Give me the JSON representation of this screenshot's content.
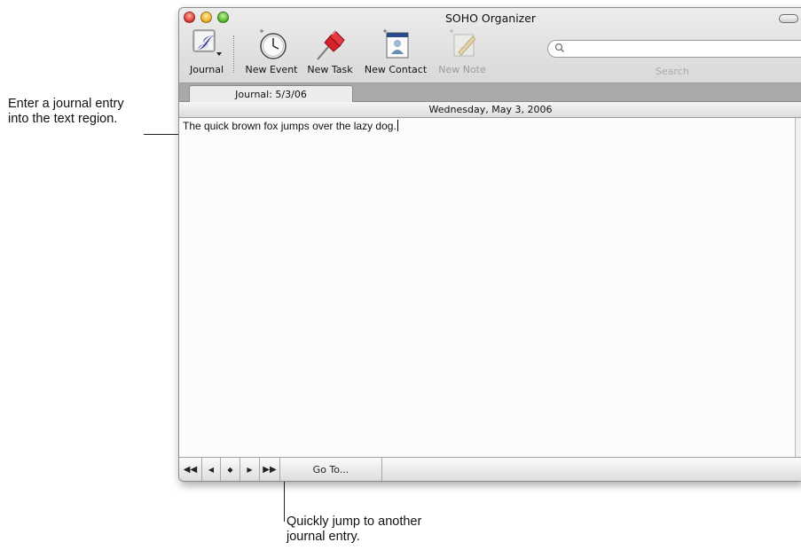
{
  "callouts": {
    "journal_entry": [
      "Enter a journal entry",
      "into the text region."
    ],
    "jump": [
      "Quickly jump to another",
      "journal entry."
    ]
  },
  "window": {
    "title": "SOHO Organizer"
  },
  "toolbar": {
    "journal": {
      "label": "Journal",
      "icon": "journal-icon"
    },
    "new_event": {
      "label": "New Event",
      "icon": "clock-icon"
    },
    "new_task": {
      "label": "New Task",
      "icon": "pushpin-icon"
    },
    "new_contact": {
      "label": "New Contact",
      "icon": "contact-card-icon"
    },
    "new_note": {
      "label": "New Note",
      "icon": "note-pencil-icon",
      "enabled": false
    },
    "search": {
      "value": "",
      "label": "Search",
      "icon": "search-icon"
    }
  },
  "tab": {
    "label": "Journal: 5/3/06"
  },
  "journal": {
    "date": "Wednesday, May 3, 2006",
    "entry": "The quick brown fox jumps over the lazy dog."
  },
  "navigation": {
    "first": "◀◀",
    "prev": "◀",
    "today": "◆",
    "next": "▶",
    "last": "▶▶",
    "goto": "Go To..."
  },
  "colors": {
    "close": "#e0443a",
    "minimize": "#f2b730",
    "zoom": "#5cbf32",
    "pin": "#d8202a",
    "tabbar": "#a9a9a9"
  }
}
